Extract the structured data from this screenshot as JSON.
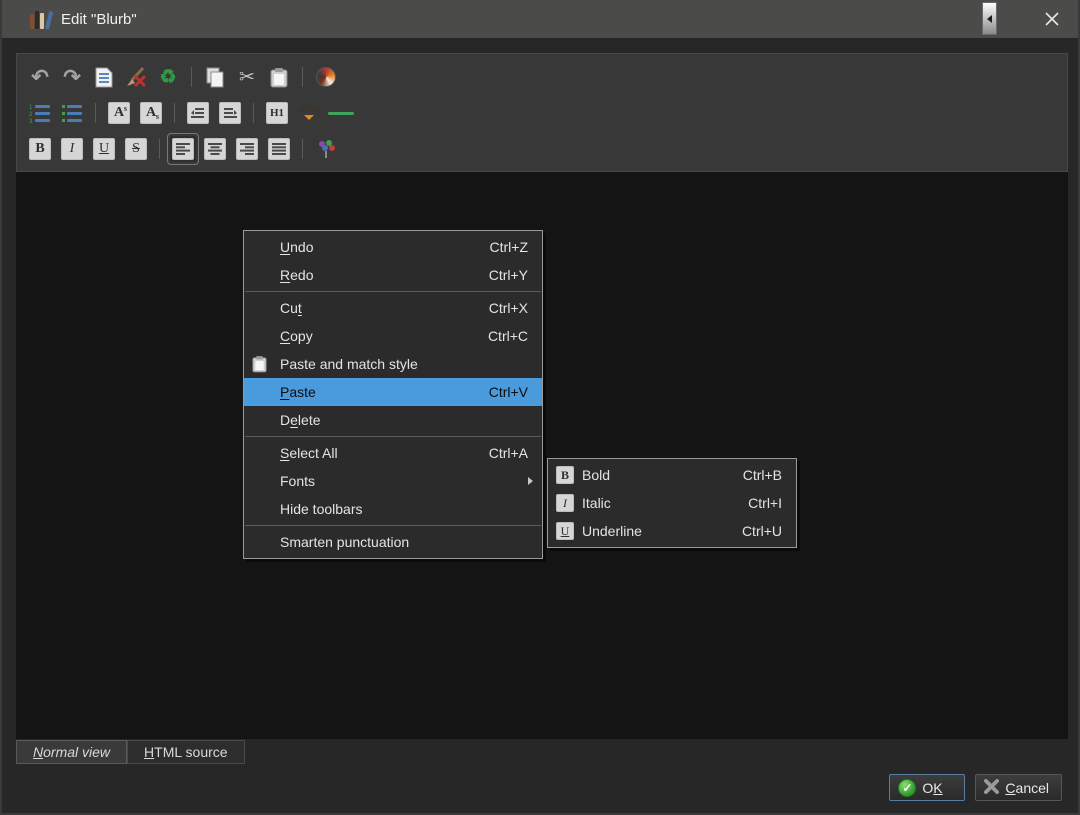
{
  "colors": {
    "titlebar": "#4b4b4a",
    "dialog_bg": "#272727",
    "toolbar_bg": "#383838",
    "editor_bg": "#141414",
    "menu_bg": "#2b2b2b",
    "highlight": "#4a9ade",
    "highlight_text": "#0d0d0d",
    "ok_icon_green": "#2f9b30",
    "rule_green": "#3fa55a"
  },
  "window": {
    "title": "Edit \"Blurb\""
  },
  "toolbar": {
    "row1_icons": [
      "undo",
      "redo",
      "document",
      "clean-formatting",
      "recycle",
      "copy",
      "cut",
      "paste",
      "insert-link"
    ],
    "row2_icons": [
      "ordered-list",
      "bullet-list",
      "superscript",
      "subscript",
      "outdent",
      "indent",
      "heading-style",
      "background-color",
      "horizontal-rule"
    ],
    "row3_icons": [
      "bold",
      "italic",
      "underline",
      "strikethrough",
      "align-left",
      "align-center",
      "align-right",
      "align-justify",
      "text-color"
    ],
    "active_button": "align-left",
    "glyphs": {
      "undo": "↶",
      "redo": "↷",
      "recycle": "♻",
      "cut": "✂",
      "bold": "B",
      "italic": "I",
      "underline": "U",
      "strike": "S",
      "sup_base": "A",
      "sup_mark": "s",
      "sub_base": "A",
      "sub_mark": "s",
      "heading": "H1"
    }
  },
  "context_menu": {
    "items": [
      {
        "pre": "",
        "mn": "U",
        "post": "ndo",
        "shortcut": "Ctrl+Z"
      },
      {
        "pre": "",
        "mn": "R",
        "post": "edo",
        "shortcut": "Ctrl+Y"
      },
      {
        "pre": "Cu",
        "mn": "t",
        "post": "",
        "shortcut": "Ctrl+X"
      },
      {
        "pre": "",
        "mn": "C",
        "post": "opy",
        "shortcut": "Ctrl+C"
      },
      {
        "pre": "Paste and match style",
        "mn": "",
        "post": "",
        "shortcut": ""
      },
      {
        "pre": "",
        "mn": "P",
        "post": "aste",
        "shortcut": "Ctrl+V"
      },
      {
        "pre": "D",
        "mn": "e",
        "post": "lete",
        "shortcut": ""
      },
      {
        "pre": "",
        "mn": "S",
        "post": "elect All",
        "shortcut": "Ctrl+A"
      },
      {
        "pre": "Fonts",
        "mn": "",
        "post": "",
        "shortcut": ""
      },
      {
        "pre": "Hide toolbars",
        "mn": "",
        "post": "",
        "shortcut": ""
      },
      {
        "pre": "Smarten punctuation",
        "mn": "",
        "post": "",
        "shortcut": ""
      }
    ],
    "highlighted_item": "Paste"
  },
  "fonts_submenu": {
    "items": [
      {
        "icon": "B",
        "label": "Bold",
        "shortcut": "Ctrl+B"
      },
      {
        "icon": "I",
        "label": "Italic",
        "shortcut": "Ctrl+I"
      },
      {
        "icon": "U",
        "label": "Underline",
        "shortcut": "Ctrl+U"
      }
    ]
  },
  "tabs": [
    {
      "pre": "",
      "mn": "N",
      "post": "ormal view"
    },
    {
      "pre": "",
      "mn": "H",
      "post": "TML source"
    }
  ],
  "footer": {
    "ok": {
      "pre": "O",
      "mn": "K",
      "post": "",
      "icon_glyph": "✓"
    },
    "cancel": {
      "pre": "",
      "mn": "C",
      "post": "ancel"
    }
  }
}
